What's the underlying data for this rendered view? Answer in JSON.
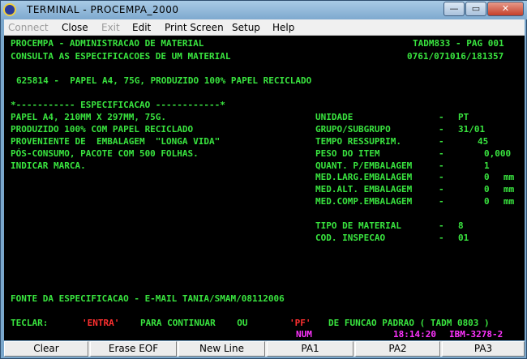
{
  "window": {
    "title": "TERMINAL - PROCEMPA_2000",
    "minimize_glyph": "—",
    "maximize_glyph": "▭",
    "close_glyph": "✕"
  },
  "menu": [
    {
      "label": "Connect",
      "disabled": true
    },
    {
      "label": "Close",
      "disabled": false
    },
    {
      "label": "Exit",
      "disabled": true
    },
    {
      "label": "Edit",
      "disabled": false
    },
    {
      "label": "Print Screen",
      "disabled": false
    },
    {
      "label": "Setup",
      "disabled": false
    },
    {
      "label": "Help",
      "disabled": false
    }
  ],
  "screen": {
    "header_left_1": "PROCEMPA - ADMINISTRACAO DE MATERIAL",
    "header_right_1": "TADM833 - PAG 001",
    "header_left_2": "CONSULTA AS ESPECIFICACOES DE UM MATERIAL",
    "header_right_2": "0761/071016/181357",
    "material_line": "625814 -  PAPEL A4, 75G, PRODUZIDO 100% PAPEL RECICLADO",
    "spec_title": "*----------- ESPECIFICACAO ------------*",
    "spec_lines": [
      "PAPEL A4, 210MM X 297MM, 75G.",
      "PRODUZIDO 100% COM PAPEL RECICLADO",
      "PROVENIENTE DE  EMBALAGEM  \"LONGA VIDA\"",
      "PÓS-CONSUMO, PACOTE COM 500 FOLHAS.",
      "INDICAR MARCA."
    ],
    "attributes": [
      {
        "label": "UNIDADE",
        "value": "PT",
        "unit": ""
      },
      {
        "label": "GRUPO/SUBGRUPO",
        "value": "31/01",
        "unit": ""
      },
      {
        "label": "TEMPO RESSUPRIM.",
        "value": "45",
        "unit": ""
      },
      {
        "label": "PESO DO ITEM",
        "value": "0,000",
        "unit": ""
      },
      {
        "label": "QUANT. P/EMBALAGEM",
        "value": "1",
        "unit": ""
      },
      {
        "label": "MED.LARG.EMBALAGEM",
        "value": "0",
        "unit": "mm"
      },
      {
        "label": "MED.ALT. EMBALAGEM",
        "value": "0",
        "unit": "mm"
      },
      {
        "label": "MED.COMP.EMBALAGEM",
        "value": "0",
        "unit": "mm"
      }
    ],
    "tipo_label": "TIPO DE MATERIAL",
    "tipo_value": "8",
    "cod_label": "COD. INSPECAO",
    "cod_value": "01",
    "source_line": "FONTE DA ESPECIFICACAO - E-MAIL TANIA/SMAM/08112006",
    "footer_teclar": "TECLAR:",
    "footer_entra": "'ENTRA'",
    "footer_continuar": "PARA CONTINUAR    OU",
    "footer_pf": "'PF'",
    "footer_rest": "DE FUNCAO PADRAO ( TADM 0803 )",
    "status_num": "NUM",
    "status_time": "18:14:20",
    "status_model": "IBM-3278-2"
  },
  "fkeys": [
    "Clear",
    "Erase EOF",
    "New Line",
    "PA1",
    "PA2",
    "PA3"
  ]
}
